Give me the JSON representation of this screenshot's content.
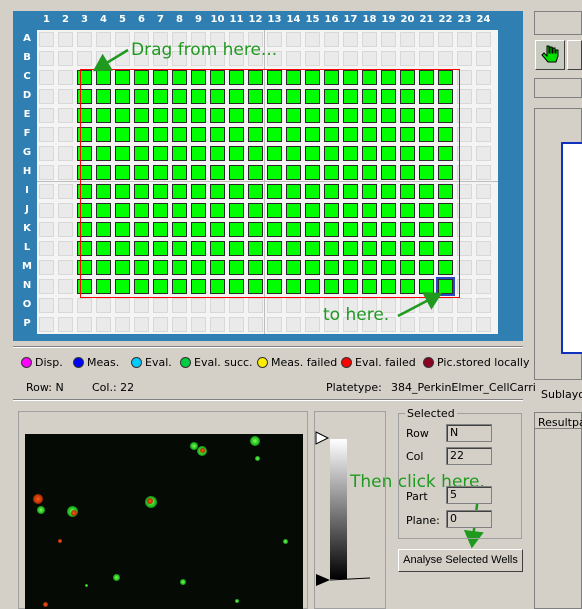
{
  "plate": {
    "columns": [
      "1",
      "2",
      "3",
      "4",
      "5",
      "6",
      "7",
      "8",
      "9",
      "10",
      "11",
      "12",
      "13",
      "14",
      "15",
      "16",
      "17",
      "18",
      "19",
      "20",
      "21",
      "22",
      "23",
      "24"
    ],
    "rows": [
      "A",
      "B",
      "C",
      "D",
      "E",
      "F",
      "G",
      "H",
      "I",
      "J",
      "K",
      "L",
      "M",
      "N",
      "O",
      "P"
    ],
    "selection": {
      "from_row": "C",
      "to_row": "N",
      "from_col": 3,
      "to_col": 22
    },
    "current_well": {
      "row": "N",
      "col": 22
    },
    "colors": {
      "well_selected": "#00ff00",
      "well_empty": "#eaeaea",
      "selection_border": "#ff0000",
      "panel": "#2f7fb3"
    }
  },
  "annotations": {
    "drag_from": "Drag from here...",
    "to_here": "to here.",
    "then_click": "Then click here.",
    "color": "#1f9a1f"
  },
  "legend": [
    {
      "label": "Disp.",
      "color": "#ff00ff"
    },
    {
      "label": "Meas.",
      "color": "#0000ff"
    },
    {
      "label": "Eval.",
      "color": "#00ccff"
    },
    {
      "label": "Eval. succ.",
      "color": "#00cc44"
    },
    {
      "label": "Meas. failed",
      "color": "#ffee00"
    },
    {
      "label": "Eval. failed",
      "color": "#ff0000"
    },
    {
      "label": "Pic.stored locally",
      "color": "#8b0020"
    }
  ],
  "status": {
    "row_label": "Row: N",
    "col_label": "Col.: 22",
    "platetype_label": "Platetype:",
    "platetype_value": "384_PerkinElmer_CellCarri"
  },
  "selected": {
    "title": "Selected",
    "fields": [
      {
        "label": "Row",
        "value": "N"
      },
      {
        "label": "Col",
        "value": "22"
      },
      {
        "label": "Part",
        "value": "5"
      },
      {
        "label": "Plane:",
        "value": "0"
      }
    ]
  },
  "analyse_button": "Analyse Selected Wells",
  "right_panel": {
    "sublayout_label": "Sublayou",
    "result_label": "Resultpar",
    "hand_icon": "hand-pointer-icon"
  }
}
